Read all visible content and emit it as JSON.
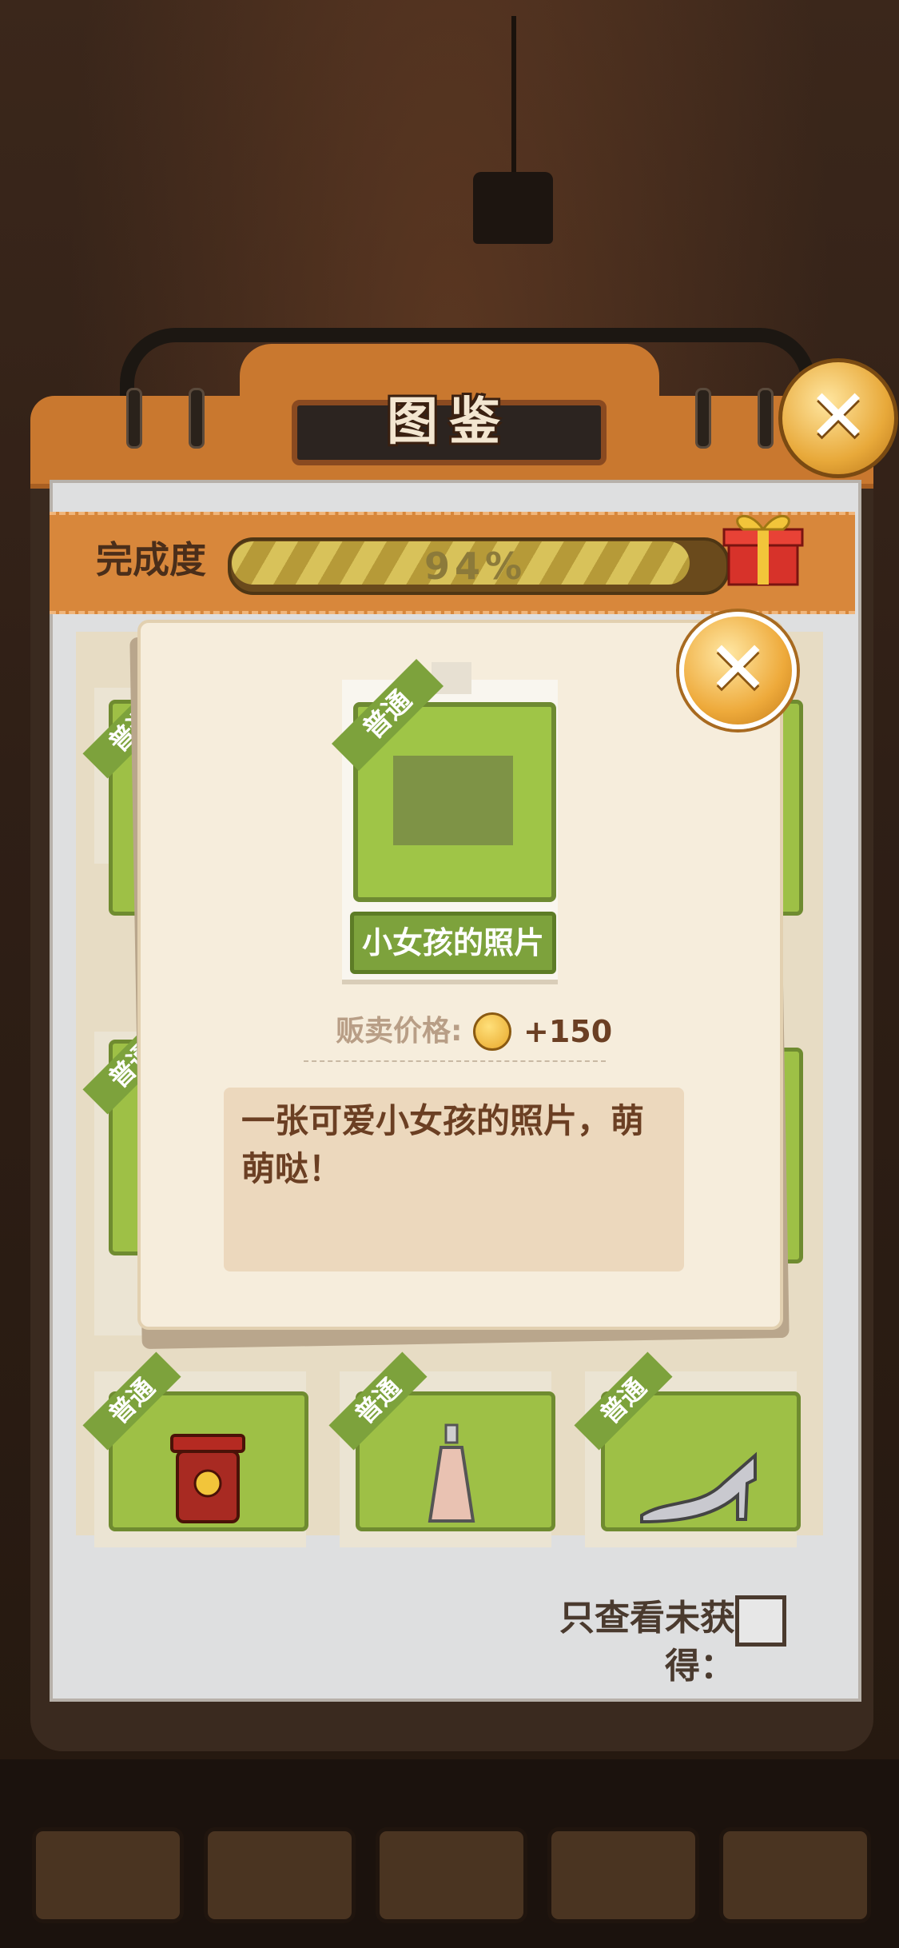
{
  "panel": {
    "title": "图鉴",
    "completion_label": "完成度",
    "completion_percent_text": "94%",
    "completion_value": 0.94,
    "filter_label": "只查看未获得：",
    "filter_checked": false
  },
  "grid": {
    "rarity_label": "普通"
  },
  "modal": {
    "rarity": "普通",
    "item_name": "小女孩的照片",
    "price_label": "贩卖价格:",
    "price_value": "+150",
    "description": "一张可爱小女孩的照片，萌萌哒！"
  },
  "colors": {
    "panel_orange": "#c9782f",
    "card_green": "#9ec046",
    "ribbon_green": "#7da23c",
    "text_brown": "#6b3f23"
  },
  "icons": {
    "close": "close-icon",
    "gift": "gift-icon",
    "coin": "coin-icon"
  }
}
